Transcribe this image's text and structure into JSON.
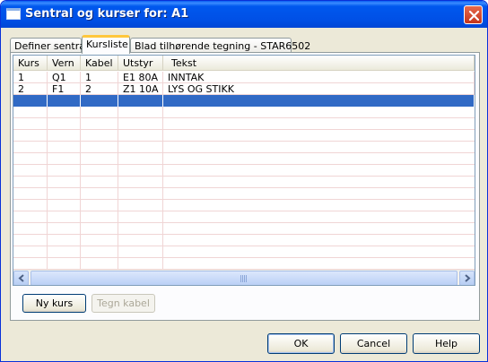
{
  "window": {
    "title": "Sentral og kurser for: A1"
  },
  "tabs": [
    {
      "label": "Definer sentral"
    },
    {
      "label": "Kursliste"
    },
    {
      "label": "Blad tilhørende tegning - STAR6502"
    }
  ],
  "list": {
    "columns": [
      "Kurs",
      "Vern",
      "Kabel",
      "Utstyr",
      "Tekst"
    ],
    "rows": [
      [
        "1",
        "Q1",
        "1",
        "E1 80A",
        "INNTAK"
      ],
      [
        "2",
        "F1",
        "2",
        "Z1 10A",
        "LYS OG STIKK"
      ],
      [
        "",
        "",
        "",
        "",
        ""
      ]
    ],
    "selected_row": 3
  },
  "panel_buttons": {
    "new_course": "Ny kurs",
    "draw_cable": "Tegn kabel"
  },
  "dialog_buttons": {
    "ok": "OK",
    "cancel": "Cancel",
    "help": "Help"
  },
  "colors": {
    "selection": "#316ac5",
    "titlebar": "#0050e6",
    "grid_line": "#f0d5d5"
  },
  "icons": [
    "window-icon",
    "close-icon",
    "scroll-left-icon",
    "scroll-right-icon"
  ]
}
